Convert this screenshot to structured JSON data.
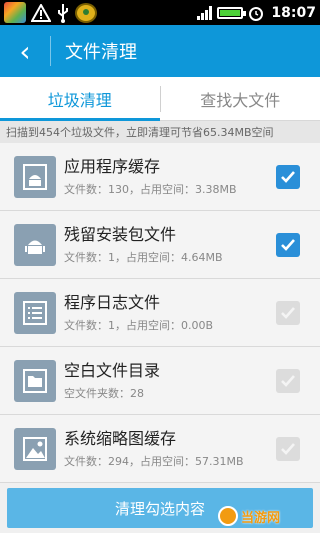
{
  "status_bar": {
    "time": "18:07"
  },
  "app_bar": {
    "back_label": "‹",
    "title": "文件清理"
  },
  "tabs": [
    {
      "label": "垃圾清理",
      "active": true
    },
    {
      "label": "查找大文件",
      "active": false
    }
  ],
  "summary": "扫描到454个垃圾文件，立即清理可节省65.34MB空间",
  "items": [
    {
      "icon": "android-app-cache-icon",
      "title": "应用程序缓存",
      "subtitle": "文件数：130，占用空间：3.38MB",
      "checked": true
    },
    {
      "icon": "android-apk-icon",
      "title": "残留安装包文件",
      "subtitle": "文件数：1，占用空间：4.64MB",
      "checked": true
    },
    {
      "icon": "log-list-icon",
      "title": "程序日志文件",
      "subtitle": "文件数：1，占用空间：0.00B",
      "checked": false
    },
    {
      "icon": "folder-icon",
      "title": "空白文件目录",
      "subtitle": "空文件夹数：28",
      "checked": false
    },
    {
      "icon": "image-icon",
      "title": "系统缩略图缓存",
      "subtitle": "文件数：294，占用空间：57.31MB",
      "checked": false
    }
  ],
  "clean_button": "清理勾选内容",
  "watermark": "当游网"
}
